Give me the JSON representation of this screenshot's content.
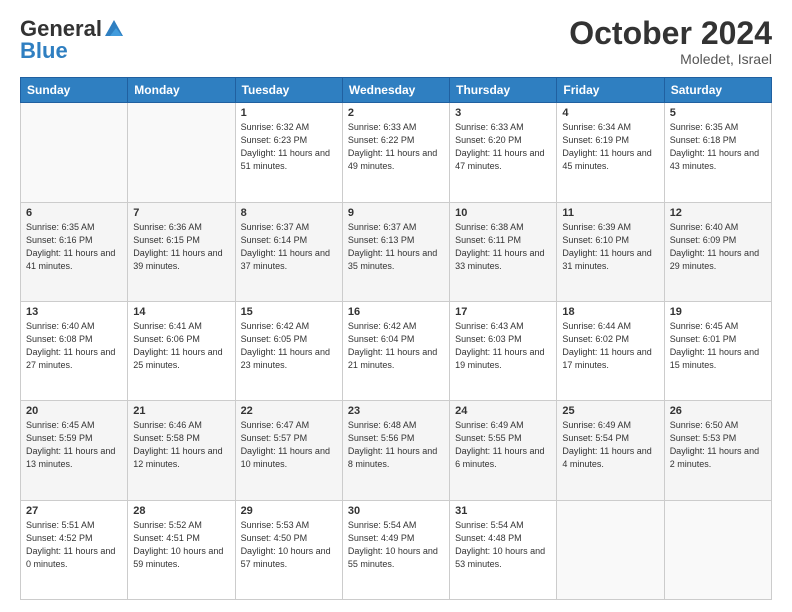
{
  "header": {
    "logo_general": "General",
    "logo_blue": "Blue",
    "month": "October 2024",
    "location": "Moledet, Israel"
  },
  "weekdays": [
    "Sunday",
    "Monday",
    "Tuesday",
    "Wednesday",
    "Thursday",
    "Friday",
    "Saturday"
  ],
  "weeks": [
    [
      {
        "day": "",
        "sunrise": "",
        "sunset": "",
        "daylight": ""
      },
      {
        "day": "",
        "sunrise": "",
        "sunset": "",
        "daylight": ""
      },
      {
        "day": "1",
        "sunrise": "Sunrise: 6:32 AM",
        "sunset": "Sunset: 6:23 PM",
        "daylight": "Daylight: 11 hours and 51 minutes."
      },
      {
        "day": "2",
        "sunrise": "Sunrise: 6:33 AM",
        "sunset": "Sunset: 6:22 PM",
        "daylight": "Daylight: 11 hours and 49 minutes."
      },
      {
        "day": "3",
        "sunrise": "Sunrise: 6:33 AM",
        "sunset": "Sunset: 6:20 PM",
        "daylight": "Daylight: 11 hours and 47 minutes."
      },
      {
        "day": "4",
        "sunrise": "Sunrise: 6:34 AM",
        "sunset": "Sunset: 6:19 PM",
        "daylight": "Daylight: 11 hours and 45 minutes."
      },
      {
        "day": "5",
        "sunrise": "Sunrise: 6:35 AM",
        "sunset": "Sunset: 6:18 PM",
        "daylight": "Daylight: 11 hours and 43 minutes."
      }
    ],
    [
      {
        "day": "6",
        "sunrise": "Sunrise: 6:35 AM",
        "sunset": "Sunset: 6:16 PM",
        "daylight": "Daylight: 11 hours and 41 minutes."
      },
      {
        "day": "7",
        "sunrise": "Sunrise: 6:36 AM",
        "sunset": "Sunset: 6:15 PM",
        "daylight": "Daylight: 11 hours and 39 minutes."
      },
      {
        "day": "8",
        "sunrise": "Sunrise: 6:37 AM",
        "sunset": "Sunset: 6:14 PM",
        "daylight": "Daylight: 11 hours and 37 minutes."
      },
      {
        "day": "9",
        "sunrise": "Sunrise: 6:37 AM",
        "sunset": "Sunset: 6:13 PM",
        "daylight": "Daylight: 11 hours and 35 minutes."
      },
      {
        "day": "10",
        "sunrise": "Sunrise: 6:38 AM",
        "sunset": "Sunset: 6:11 PM",
        "daylight": "Daylight: 11 hours and 33 minutes."
      },
      {
        "day": "11",
        "sunrise": "Sunrise: 6:39 AM",
        "sunset": "Sunset: 6:10 PM",
        "daylight": "Daylight: 11 hours and 31 minutes."
      },
      {
        "day": "12",
        "sunrise": "Sunrise: 6:40 AM",
        "sunset": "Sunset: 6:09 PM",
        "daylight": "Daylight: 11 hours and 29 minutes."
      }
    ],
    [
      {
        "day": "13",
        "sunrise": "Sunrise: 6:40 AM",
        "sunset": "Sunset: 6:08 PM",
        "daylight": "Daylight: 11 hours and 27 minutes."
      },
      {
        "day": "14",
        "sunrise": "Sunrise: 6:41 AM",
        "sunset": "Sunset: 6:06 PM",
        "daylight": "Daylight: 11 hours and 25 minutes."
      },
      {
        "day": "15",
        "sunrise": "Sunrise: 6:42 AM",
        "sunset": "Sunset: 6:05 PM",
        "daylight": "Daylight: 11 hours and 23 minutes."
      },
      {
        "day": "16",
        "sunrise": "Sunrise: 6:42 AM",
        "sunset": "Sunset: 6:04 PM",
        "daylight": "Daylight: 11 hours and 21 minutes."
      },
      {
        "day": "17",
        "sunrise": "Sunrise: 6:43 AM",
        "sunset": "Sunset: 6:03 PM",
        "daylight": "Daylight: 11 hours and 19 minutes."
      },
      {
        "day": "18",
        "sunrise": "Sunrise: 6:44 AM",
        "sunset": "Sunset: 6:02 PM",
        "daylight": "Daylight: 11 hours and 17 minutes."
      },
      {
        "day": "19",
        "sunrise": "Sunrise: 6:45 AM",
        "sunset": "Sunset: 6:01 PM",
        "daylight": "Daylight: 11 hours and 15 minutes."
      }
    ],
    [
      {
        "day": "20",
        "sunrise": "Sunrise: 6:45 AM",
        "sunset": "Sunset: 5:59 PM",
        "daylight": "Daylight: 11 hours and 13 minutes."
      },
      {
        "day": "21",
        "sunrise": "Sunrise: 6:46 AM",
        "sunset": "Sunset: 5:58 PM",
        "daylight": "Daylight: 11 hours and 12 minutes."
      },
      {
        "day": "22",
        "sunrise": "Sunrise: 6:47 AM",
        "sunset": "Sunset: 5:57 PM",
        "daylight": "Daylight: 11 hours and 10 minutes."
      },
      {
        "day": "23",
        "sunrise": "Sunrise: 6:48 AM",
        "sunset": "Sunset: 5:56 PM",
        "daylight": "Daylight: 11 hours and 8 minutes."
      },
      {
        "day": "24",
        "sunrise": "Sunrise: 6:49 AM",
        "sunset": "Sunset: 5:55 PM",
        "daylight": "Daylight: 11 hours and 6 minutes."
      },
      {
        "day": "25",
        "sunrise": "Sunrise: 6:49 AM",
        "sunset": "Sunset: 5:54 PM",
        "daylight": "Daylight: 11 hours and 4 minutes."
      },
      {
        "day": "26",
        "sunrise": "Sunrise: 6:50 AM",
        "sunset": "Sunset: 5:53 PM",
        "daylight": "Daylight: 11 hours and 2 minutes."
      }
    ],
    [
      {
        "day": "27",
        "sunrise": "Sunrise: 5:51 AM",
        "sunset": "Sunset: 4:52 PM",
        "daylight": "Daylight: 11 hours and 0 minutes."
      },
      {
        "day": "28",
        "sunrise": "Sunrise: 5:52 AM",
        "sunset": "Sunset: 4:51 PM",
        "daylight": "Daylight: 10 hours and 59 minutes."
      },
      {
        "day": "29",
        "sunrise": "Sunrise: 5:53 AM",
        "sunset": "Sunset: 4:50 PM",
        "daylight": "Daylight: 10 hours and 57 minutes."
      },
      {
        "day": "30",
        "sunrise": "Sunrise: 5:54 AM",
        "sunset": "Sunset: 4:49 PM",
        "daylight": "Daylight: 10 hours and 55 minutes."
      },
      {
        "day": "31",
        "sunrise": "Sunrise: 5:54 AM",
        "sunset": "Sunset: 4:48 PM",
        "daylight": "Daylight: 10 hours and 53 minutes."
      },
      {
        "day": "",
        "sunrise": "",
        "sunset": "",
        "daylight": ""
      },
      {
        "day": "",
        "sunrise": "",
        "sunset": "",
        "daylight": ""
      }
    ]
  ]
}
